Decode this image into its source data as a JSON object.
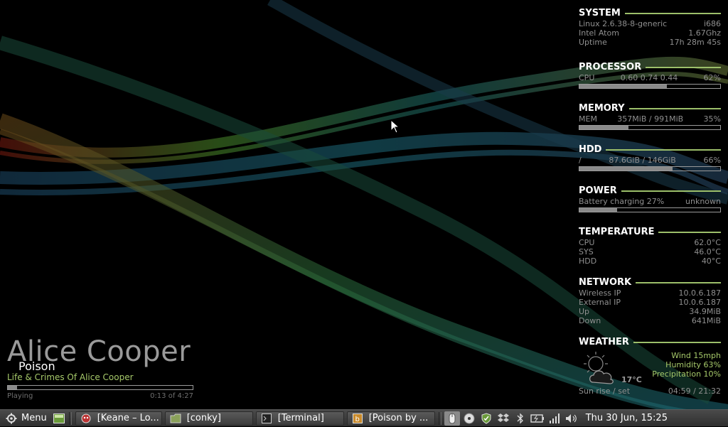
{
  "conky": {
    "system": {
      "title": "SYSTEM",
      "rows": [
        {
          "label": "Linux 2.6.38-8-generic",
          "value": "i686"
        },
        {
          "label": "Intel Atom",
          "value": "1.67Ghz"
        },
        {
          "label": "Uptime",
          "value": "17h 28m 45s"
        }
      ]
    },
    "processor": {
      "title": "PROCESSOR",
      "label": "CPU",
      "load": "0.60 0.74 0.44",
      "percent": "62%",
      "fraction": 0.62
    },
    "memory": {
      "title": "MEMORY",
      "label": "MEM",
      "usage": "357MiB / 991MiB",
      "percent": "35%",
      "fraction": 0.35
    },
    "hdd": {
      "title": "HDD",
      "label": "/",
      "usage": "87.6GiB / 146GiB",
      "percent": "66%",
      "fraction": 0.66
    },
    "power": {
      "title": "POWER",
      "label": "Battery charging 27%",
      "value": "unknown",
      "fraction": 0.27
    },
    "temperature": {
      "title": "TEMPERATURE",
      "rows": [
        {
          "label": "CPU",
          "value": "62.0°C"
        },
        {
          "label": "SYS",
          "value": "46.0°C"
        },
        {
          "label": "HDD",
          "value": "40°C"
        }
      ]
    },
    "network": {
      "title": "NETWORK",
      "rows": [
        {
          "label": "Wireless IP",
          "value": "10.0.6.187"
        },
        {
          "label": "External IP",
          "value": "10.0.6.187"
        },
        {
          "label": "Up",
          "value": "34.9MiB"
        },
        {
          "label": "Down",
          "value": "641MiB"
        }
      ]
    },
    "weather": {
      "title": "WEATHER",
      "icon": "partly-cloudy-icon",
      "temp": "17°C",
      "wind": "Wind 15mph",
      "humidity": "Humidity 63%",
      "precipitation": "Precipitation 10%",
      "sun_label": "Sun rise / set",
      "sun_value": "04:59 / 21:32"
    }
  },
  "music": {
    "artist": "Alice Cooper",
    "track": "Poison",
    "album": "Life & Crimes Of Alice Cooper",
    "status": "Playing",
    "time": "0:13 of 4:27",
    "progress": 0.05
  },
  "taskbar": {
    "menu_label": "Menu",
    "tasks": [
      {
        "label": "[Keane – Lo...",
        "icon": "music-player-icon"
      },
      {
        "label": "[conky]",
        "icon": "folder-icon"
      },
      {
        "label": "[Terminal]",
        "icon": "terminal-icon"
      },
      {
        "label": "[Poison by ...",
        "icon": "browser-icon"
      }
    ],
    "clock": "Thu 30 Jun, 15:25"
  },
  "colors": {
    "accent": "#9cbf6a",
    "text_dim": "#8f8f8f",
    "album": "#a6c96a"
  }
}
